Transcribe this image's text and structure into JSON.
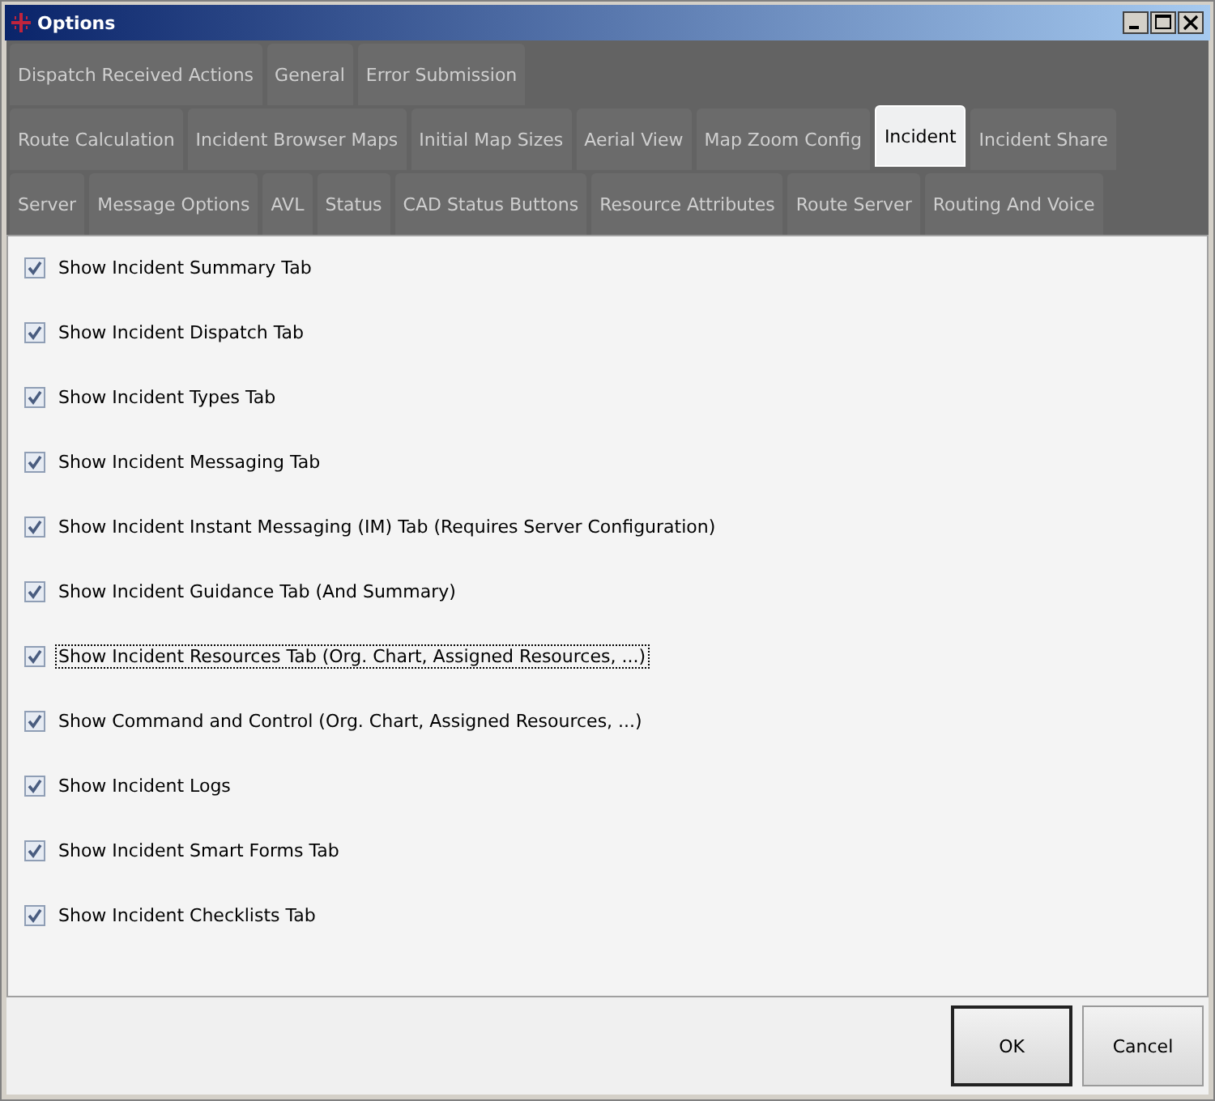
{
  "window": {
    "title": "Options"
  },
  "tab_rows": [
    [
      {
        "label": "Dispatch Received Actions",
        "selected": false
      },
      {
        "label": "General",
        "selected": false
      },
      {
        "label": "Error Submission",
        "selected": false
      }
    ],
    [
      {
        "label": "Route Calculation",
        "selected": false
      },
      {
        "label": "Incident Browser Maps",
        "selected": false
      },
      {
        "label": "Initial Map Sizes",
        "selected": false
      },
      {
        "label": "Aerial View",
        "selected": false
      },
      {
        "label": "Map Zoom Config",
        "selected": false
      },
      {
        "label": "Incident",
        "selected": true
      },
      {
        "label": "Incident Share",
        "selected": false
      }
    ],
    [
      {
        "label": "Server",
        "selected": false
      },
      {
        "label": "Message Options",
        "selected": false
      },
      {
        "label": "AVL",
        "selected": false
      },
      {
        "label": "Status",
        "selected": false
      },
      {
        "label": "CAD Status Buttons",
        "selected": false
      },
      {
        "label": "Resource Attributes",
        "selected": false
      },
      {
        "label": "Route Server",
        "selected": false
      },
      {
        "label": "Routing And Voice",
        "selected": false
      }
    ]
  ],
  "options": [
    {
      "label": "Show Incident Summary Tab",
      "checked": true,
      "focused": false
    },
    {
      "label": "Show Incident Dispatch Tab",
      "checked": true,
      "focused": false
    },
    {
      "label": "Show Incident Types Tab",
      "checked": true,
      "focused": false
    },
    {
      "label": "Show Incident Messaging Tab",
      "checked": true,
      "focused": false
    },
    {
      "label": "Show Incident Instant Messaging (IM) Tab (Requires Server Configuration)",
      "checked": true,
      "focused": false
    },
    {
      "label": "Show Incident Guidance Tab (And Summary)",
      "checked": true,
      "focused": false
    },
    {
      "label": "Show Incident Resources Tab (Org. Chart, Assigned Resources, ...)",
      "checked": true,
      "focused": true
    },
    {
      "label": "Show Command and Control (Org. Chart, Assigned Resources, ...)",
      "checked": true,
      "focused": false
    },
    {
      "label": "Show Incident Logs",
      "checked": true,
      "focused": false
    },
    {
      "label": "Show Incident Smart Forms Tab",
      "checked": true,
      "focused": false
    },
    {
      "label": "Show Incident Checklists Tab",
      "checked": true,
      "focused": false
    }
  ],
  "buttons": [
    {
      "label": "OK",
      "kind": "default"
    },
    {
      "label": "Cancel",
      "kind": "normal"
    }
  ]
}
